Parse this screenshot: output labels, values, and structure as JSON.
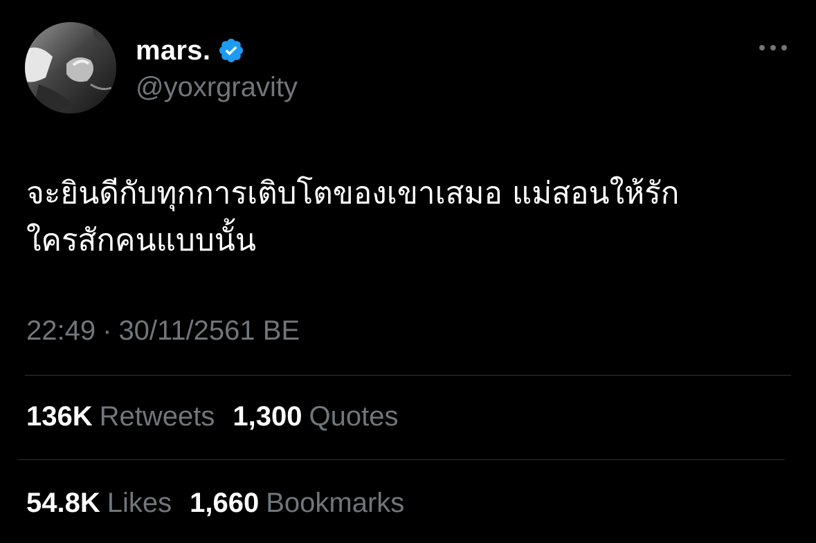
{
  "author": {
    "display_name": "mars.",
    "handle": "@yoxrgravity",
    "verified": true
  },
  "tweet": {
    "text_line1": "จะยินดีกับทุกการเติบโตของเขาเสมอ แม่สอนให้รัก",
    "text_line2": "ใครสักคนแบบนั้น"
  },
  "meta": {
    "time": "22:49",
    "separator": "·",
    "date": "30/11/2561 BE"
  },
  "stats_row1": [
    {
      "count": "136K",
      "label": "Retweets"
    },
    {
      "count": "1,300",
      "label": "Quotes"
    }
  ],
  "stats_row2": [
    {
      "count": "54.8K",
      "label": "Likes"
    },
    {
      "count": "1,660",
      "label": "Bookmarks"
    }
  ],
  "icons": {
    "verified": "verified-badge-icon",
    "more": "more-options-icon"
  },
  "colors": {
    "background": "#000000",
    "text_primary": "#ffffff",
    "text_secondary": "#71767b",
    "verified_blue": "#1d9bf0",
    "divider": "#2f3336"
  }
}
